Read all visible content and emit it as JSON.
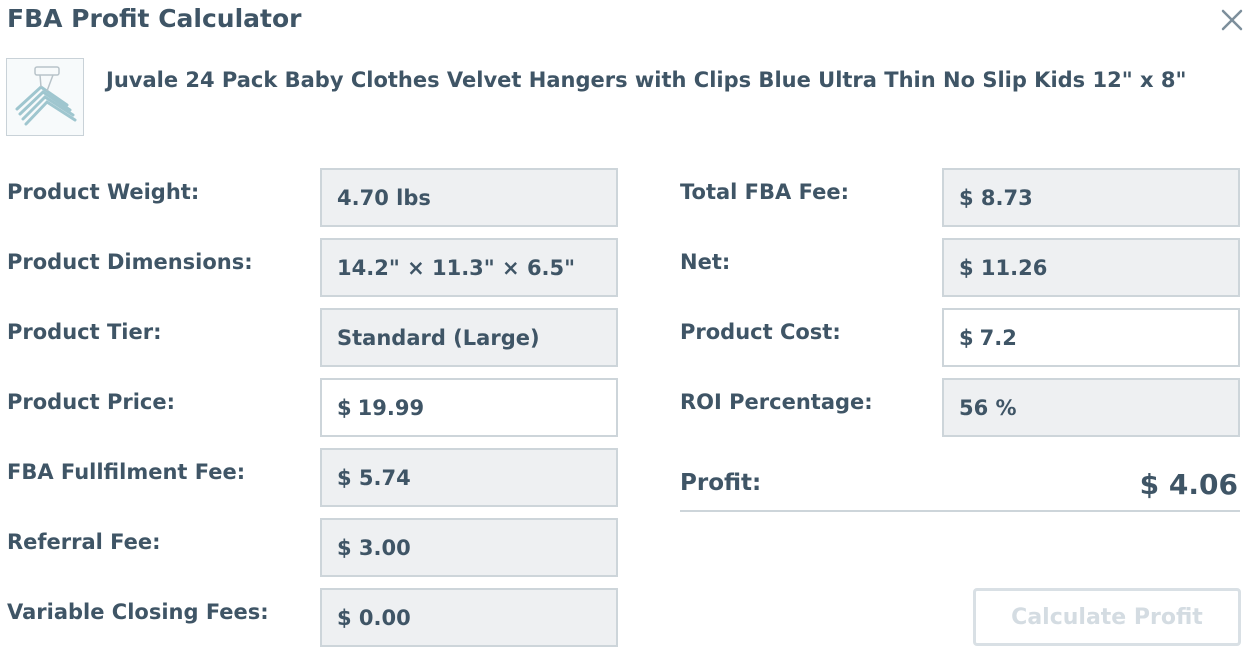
{
  "header": {
    "title": "FBA Profit Calculator"
  },
  "product": {
    "name": "Juvale 24 Pack Baby Clothes Velvet Hangers with Clips Blue Ultra Thin No Slip Kids 12\" x 8\""
  },
  "left_fields": [
    {
      "label": "Product Weight:",
      "value": "4.70 lbs"
    },
    {
      "label": "Product Dimensions:",
      "value": "14.2\" × 11.3\" × 6.5\""
    },
    {
      "label": "Product Tier:",
      "value": "Standard (Large)"
    },
    {
      "label": "Product Price:",
      "currency": "$",
      "value": "19.99"
    },
    {
      "label": "FBA Fullfilment Fee:",
      "value": "$ 5.74"
    },
    {
      "label": "Referral Fee:",
      "value": "$ 3.00"
    },
    {
      "label": "Variable Closing Fees:",
      "value": "$ 0.00"
    }
  ],
  "right_fields": [
    {
      "label": "Total FBA Fee:",
      "value": "$ 8.73"
    },
    {
      "label": "Net:",
      "value": "$ 11.26"
    },
    {
      "label": "Product Cost:",
      "currency": "$",
      "value": "7.2"
    },
    {
      "label": "ROI Percentage:",
      "value": "56 %"
    }
  ],
  "profit": {
    "label": "Profit:",
    "value": "$ 4.06"
  },
  "actions": {
    "calculate_label": "Calculate Profit"
  },
  "colors": {
    "text": "#3f5566",
    "readonly_bg": "#eef0f2",
    "border": "#cdd5da",
    "disabled_button_text": "#d4dce2"
  }
}
